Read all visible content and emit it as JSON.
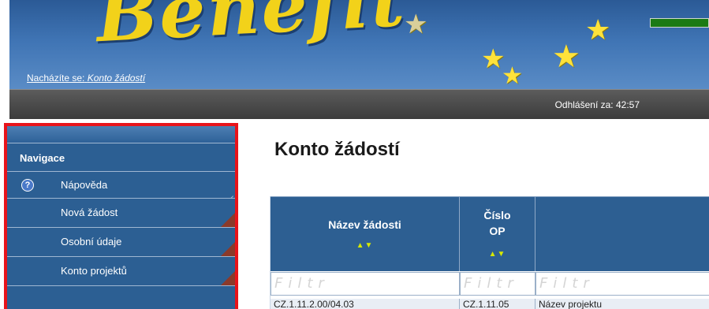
{
  "banner": {
    "logo_text": "Benefit",
    "location_label": "Nacházíte se:",
    "location_value": "Konto žádostí"
  },
  "status": {
    "logout_label": "Odhlášení za:",
    "logout_time": "42:57"
  },
  "sidebar": {
    "header": "Navigace",
    "items": [
      {
        "label": "Nápověda",
        "icon": "help-icon"
      },
      {
        "label": "Nová žádost"
      },
      {
        "label": "Osobní údaje"
      },
      {
        "label": "Konto projektů"
      }
    ]
  },
  "main": {
    "title": "Konto žádostí",
    "columns": [
      {
        "title": "Název žádosti",
        "sort": "▲▼"
      },
      {
        "title": "Číslo\nOP",
        "sort": "▲▼"
      },
      {
        "title": "",
        "sort": ""
      }
    ],
    "filter_placeholder": "Filtr",
    "row": [
      "CZ.1.11.2.00/04.03",
      "CZ.1.11.05",
      "Název projektu"
    ]
  },
  "colors": {
    "nav_bg": "#2c5f93",
    "highlight_border": "#e8131a",
    "header_bg": "#2d5f92",
    "sort_arrows": "#d6e800",
    "logout_bar": "#1b7a14"
  }
}
